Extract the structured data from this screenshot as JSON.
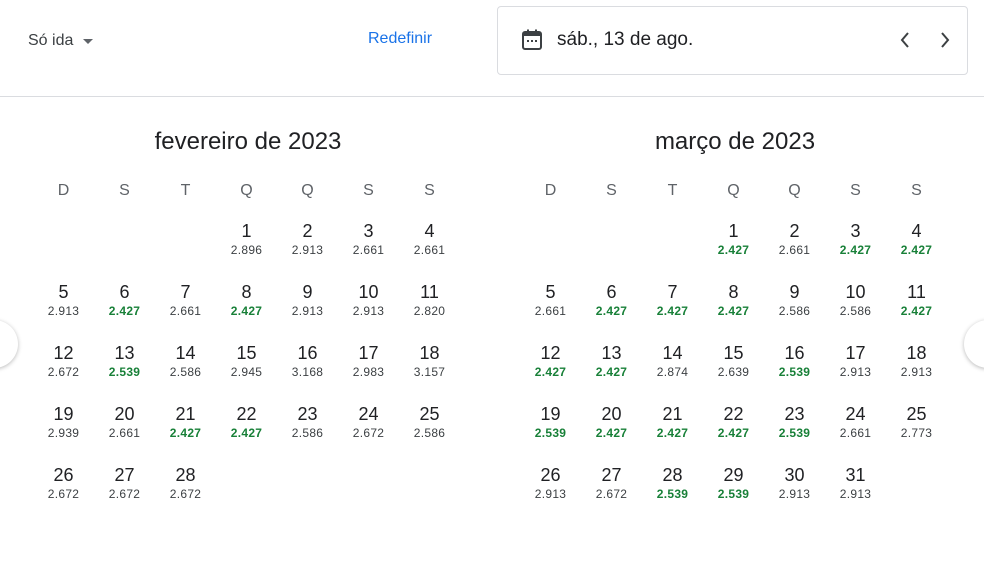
{
  "toolbar": {
    "trip_type": "Só ida",
    "reset_label": "Redefinir",
    "selected_date": "sáb., 13 de ago."
  },
  "colors": {
    "accent": "#1a73e8",
    "low_price": "#188038",
    "text": "#202124"
  },
  "icons": [
    "chevron-down-icon",
    "calendar-icon",
    "chevron-left-icon",
    "chevron-right-icon"
  ],
  "weekdays": [
    "D",
    "S",
    "T",
    "Q",
    "Q",
    "S",
    "S"
  ],
  "months": [
    {
      "title": "fevereiro de 2023",
      "offset": 3,
      "days": [
        {
          "d": "1",
          "p": "2.896",
          "low": false
        },
        {
          "d": "2",
          "p": "2.913",
          "low": false
        },
        {
          "d": "3",
          "p": "2.661",
          "low": false
        },
        {
          "d": "4",
          "p": "2.661",
          "low": false
        },
        {
          "d": "5",
          "p": "2.913",
          "low": false
        },
        {
          "d": "6",
          "p": "2.427",
          "low": true
        },
        {
          "d": "7",
          "p": "2.661",
          "low": false
        },
        {
          "d": "8",
          "p": "2.427",
          "low": true
        },
        {
          "d": "9",
          "p": "2.913",
          "low": false
        },
        {
          "d": "10",
          "p": "2.913",
          "low": false
        },
        {
          "d": "11",
          "p": "2.820",
          "low": false
        },
        {
          "d": "12",
          "p": "2.672",
          "low": false
        },
        {
          "d": "13",
          "p": "2.539",
          "low": true
        },
        {
          "d": "14",
          "p": "2.586",
          "low": false
        },
        {
          "d": "15",
          "p": "2.945",
          "low": false
        },
        {
          "d": "16",
          "p": "3.168",
          "low": false
        },
        {
          "d": "17",
          "p": "2.983",
          "low": false
        },
        {
          "d": "18",
          "p": "3.157",
          "low": false
        },
        {
          "d": "19",
          "p": "2.939",
          "low": false
        },
        {
          "d": "20",
          "p": "2.661",
          "low": false
        },
        {
          "d": "21",
          "p": "2.427",
          "low": true
        },
        {
          "d": "22",
          "p": "2.427",
          "low": true
        },
        {
          "d": "23",
          "p": "2.586",
          "low": false
        },
        {
          "d": "24",
          "p": "2.672",
          "low": false
        },
        {
          "d": "25",
          "p": "2.586",
          "low": false
        },
        {
          "d": "26",
          "p": "2.672",
          "low": false
        },
        {
          "d": "27",
          "p": "2.672",
          "low": false
        },
        {
          "d": "28",
          "p": "2.672",
          "low": false
        }
      ]
    },
    {
      "title": "março de 2023",
      "offset": 3,
      "days": [
        {
          "d": "1",
          "p": "2.427",
          "low": true
        },
        {
          "d": "2",
          "p": "2.661",
          "low": false
        },
        {
          "d": "3",
          "p": "2.427",
          "low": true
        },
        {
          "d": "4",
          "p": "2.427",
          "low": true
        },
        {
          "d": "5",
          "p": "2.661",
          "low": false
        },
        {
          "d": "6",
          "p": "2.427",
          "low": true
        },
        {
          "d": "7",
          "p": "2.427",
          "low": true
        },
        {
          "d": "8",
          "p": "2.427",
          "low": true
        },
        {
          "d": "9",
          "p": "2.586",
          "low": false
        },
        {
          "d": "10",
          "p": "2.586",
          "low": false
        },
        {
          "d": "11",
          "p": "2.427",
          "low": true
        },
        {
          "d": "12",
          "p": "2.427",
          "low": true
        },
        {
          "d": "13",
          "p": "2.427",
          "low": true
        },
        {
          "d": "14",
          "p": "2.874",
          "low": false
        },
        {
          "d": "15",
          "p": "2.639",
          "low": false
        },
        {
          "d": "16",
          "p": "2.539",
          "low": true
        },
        {
          "d": "17",
          "p": "2.913",
          "low": false
        },
        {
          "d": "18",
          "p": "2.913",
          "low": false
        },
        {
          "d": "19",
          "p": "2.539",
          "low": true
        },
        {
          "d": "20",
          "p": "2.427",
          "low": true
        },
        {
          "d": "21",
          "p": "2.427",
          "low": true
        },
        {
          "d": "22",
          "p": "2.427",
          "low": true
        },
        {
          "d": "23",
          "p": "2.539",
          "low": true
        },
        {
          "d": "24",
          "p": "2.661",
          "low": false
        },
        {
          "d": "25",
          "p": "2.773",
          "low": false
        },
        {
          "d": "26",
          "p": "2.913",
          "low": false
        },
        {
          "d": "27",
          "p": "2.672",
          "low": false
        },
        {
          "d": "28",
          "p": "2.539",
          "low": true
        },
        {
          "d": "29",
          "p": "2.539",
          "low": true
        },
        {
          "d": "30",
          "p": "2.913",
          "low": false
        },
        {
          "d": "31",
          "p": "2.913",
          "low": false
        }
      ]
    }
  ]
}
